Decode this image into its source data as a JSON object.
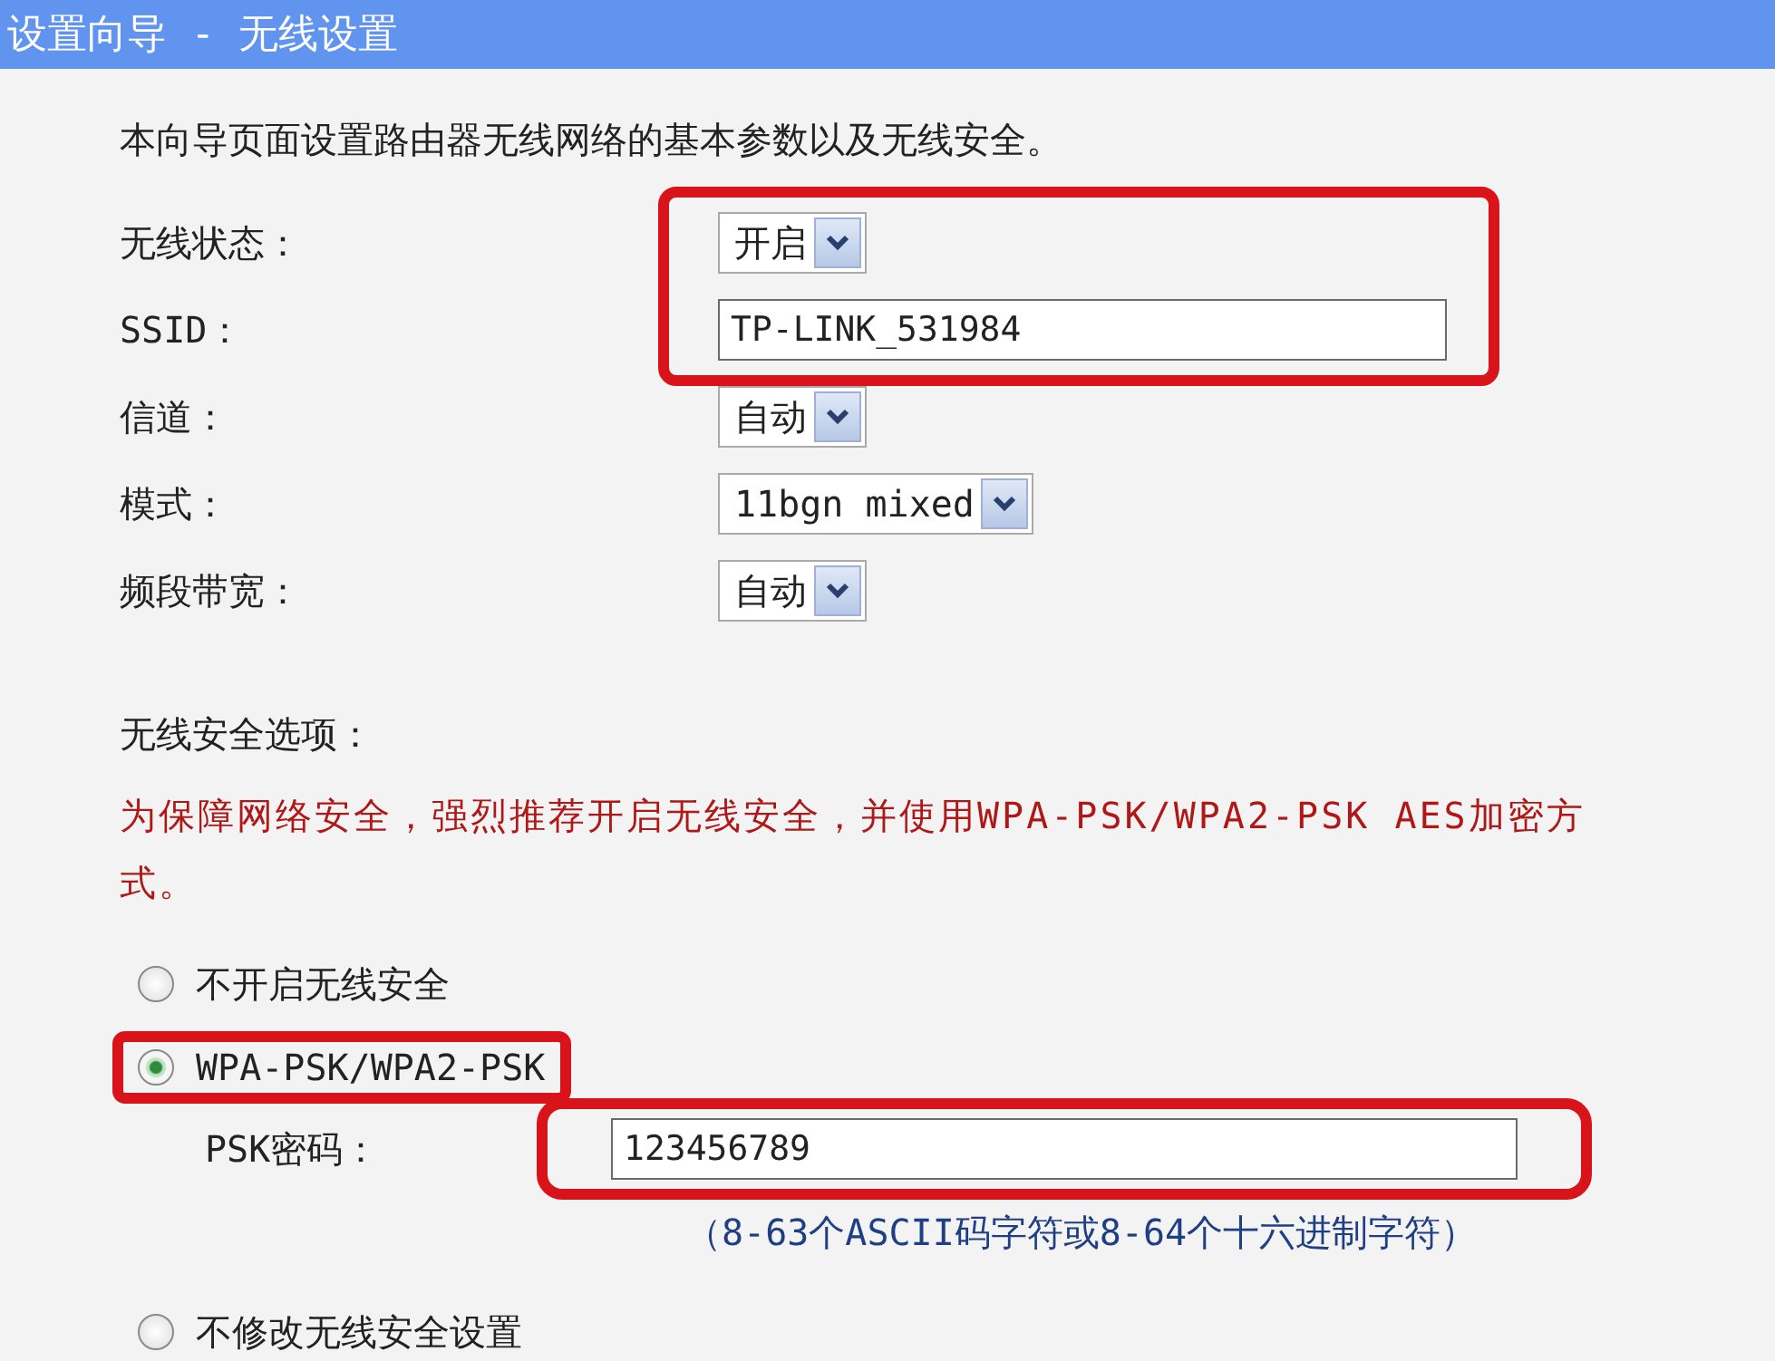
{
  "window": {
    "title": "设置向导 - 无线设置"
  },
  "intro": "本向导页面设置路由器无线网络的基本参数以及无线安全。",
  "basic_groups": [
    {
      "highlighted": true,
      "fields": [
        {
          "kind": "select",
          "label": "无线状态：",
          "value": "开启"
        },
        {
          "kind": "text",
          "label": "SSID：",
          "value": "TP-LINK_531984"
        }
      ]
    },
    {
      "highlighted": false,
      "fields": [
        {
          "kind": "select",
          "label": "信道：",
          "value": "自动"
        },
        {
          "kind": "select",
          "label": "模式：",
          "value": "11bgn mixed"
        },
        {
          "kind": "select",
          "label": "频段带宽：",
          "value": "自动"
        }
      ]
    }
  ],
  "security": {
    "heading": "无线安全选项：",
    "warning": "为保障网络安全，强烈推荐开启无线安全，并使用WPA-PSK/WPA2-PSK AES加密方式。",
    "options": [
      {
        "label": "不开启无线安全",
        "selected": false,
        "highlighted": false
      },
      {
        "label": "WPA-PSK/WPA2-PSK",
        "selected": true,
        "highlighted": true,
        "psk": {
          "label": "PSK密码：",
          "value": "123456789",
          "highlighted": true,
          "hint": "（8-63个ASCII码字符或8-64个十六进制字符）"
        }
      },
      {
        "label": "不修改无线安全设置",
        "selected": false,
        "highlighted": false
      }
    ]
  }
}
